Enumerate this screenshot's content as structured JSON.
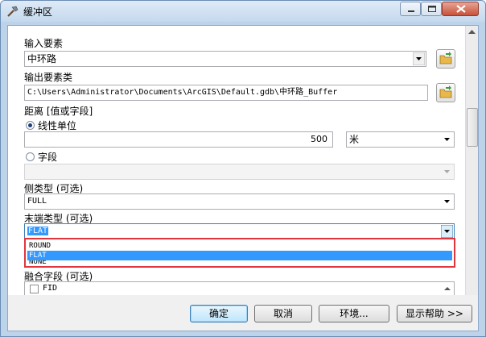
{
  "window": {
    "title": "缓冲区"
  },
  "input_features": {
    "label": "输入要素",
    "value": "中环路"
  },
  "output_feature_class": {
    "label": "输出要素类",
    "value": "C:\\Users\\Administrator\\Documents\\ArcGIS\\Default.gdb\\中环路_Buffer"
  },
  "distance": {
    "label": "距离 [值或字段]",
    "linear_unit_label": "线性单位",
    "linear_unit_value": "500",
    "unit": "米",
    "field_label": "字段",
    "field_value": ""
  },
  "side_type": {
    "label": "侧类型 (可选)",
    "value": "FULL"
  },
  "end_type": {
    "label": "末端类型 (可选)",
    "value": "FLAT",
    "options": [
      "ROUND",
      "FLAT",
      "NONE"
    ],
    "highlighted": "FLAT"
  },
  "dissolve_field": {
    "label": "融合字段 (可选)",
    "items": [
      "FID"
    ]
  },
  "buttons": {
    "ok": "确定",
    "cancel": "取消",
    "env": "环境...",
    "help": "显示帮助 >>"
  },
  "colors": {
    "highlight": "#3399ff",
    "popup_border": "#e0353d"
  }
}
